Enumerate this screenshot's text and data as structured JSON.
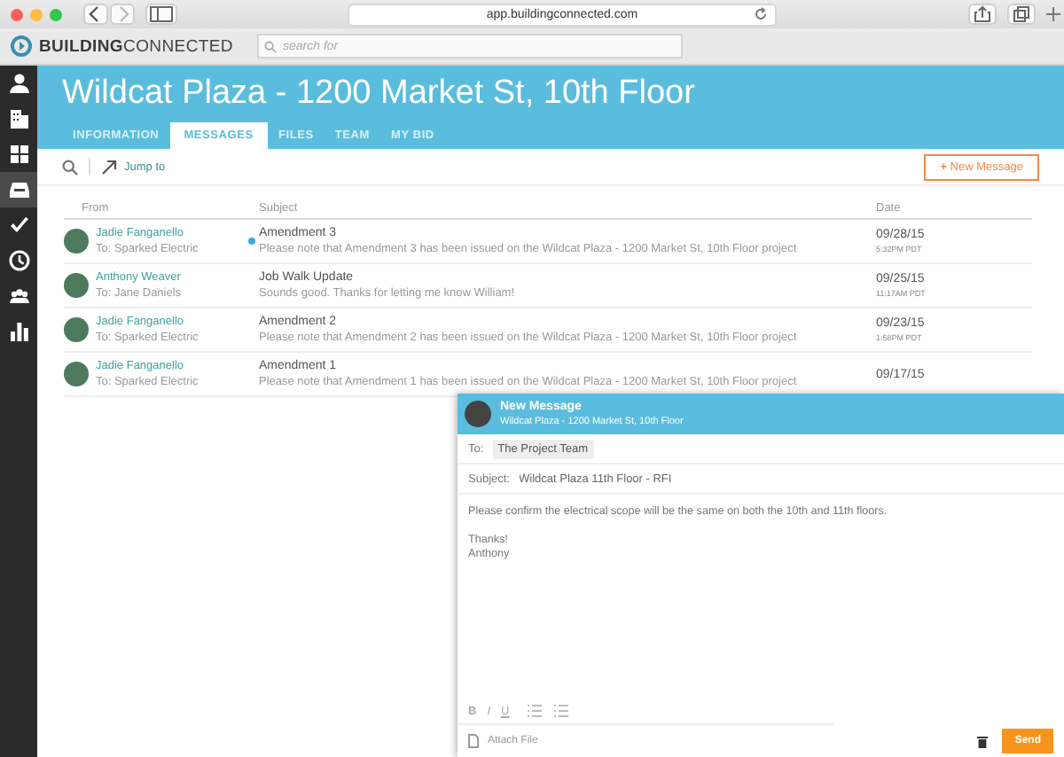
{
  "browser": {
    "url": "app.buildingconnected.com"
  },
  "app_bar": {
    "logo_bold": "BUILDING",
    "logo_light": "CONNECTED",
    "search": {
      "placeholder": "search for"
    }
  },
  "sidebar": {
    "items": [
      {
        "selected": false
      },
      {
        "selected": false
      },
      {
        "selected": false
      },
      {
        "selected": true
      },
      {
        "selected": false
      },
      {
        "selected": false
      },
      {
        "selected": false
      },
      {
        "selected": false
      }
    ]
  },
  "header": {
    "title": "Wildcat Plaza - 1200 Market St, 10th Floor"
  },
  "tabs": [
    {
      "label": "INFORMATION",
      "selected": false
    },
    {
      "label": "MESSAGES",
      "selected": true
    },
    {
      "label": "FILES",
      "selected": false
    },
    {
      "label": "TEAM",
      "selected": false
    },
    {
      "label": "MY BID",
      "selected": false
    }
  ],
  "toolbar": {
    "jump_to": "Jump to",
    "new_message": "New Message",
    "plus": "+"
  },
  "table": {
    "columns": [
      "From",
      "Subject",
      "Date"
    ],
    "rows": [
      {
        "from": "Jadie Fanganello",
        "to": "To: Sparked Electric",
        "subject": "Amendment 3",
        "preview": "Please note that Amendment 3 has been issued on the Wildcat Plaza - 1200 Market St, 10th Floor project",
        "date": "09/28/15",
        "time": "5:32PM PDT",
        "unread": true
      },
      {
        "from": "Anthony Weaver",
        "to": "To: Jane Daniels",
        "subject": "Job Walk Update",
        "preview": "Sounds good. Thanks for letting me know William!",
        "date": "09/25/15",
        "time": "11:17AM PDT",
        "unread": false
      },
      {
        "from": "Jadie Fanganello",
        "to": "To: Sparked Electric",
        "subject": "Amendment 2",
        "preview": "Please note that Amendment 2 has been issued on the Wildcat Plaza - 1200 Market St, 10th Floor project",
        "date": "09/23/15",
        "time": "1:58PM PDT",
        "unread": false
      },
      {
        "from": "Jadie Fanganello",
        "to": "To: Sparked Electric",
        "subject": "Amendment 1",
        "preview": "Please note that Amendment 1 has been issued on the Wildcat Plaza - 1200 Market St, 10th Floor project",
        "date": "09/17/15",
        "unread": false
      }
    ]
  },
  "compose": {
    "title": "New Message",
    "subtitle": "Wildcat Plaza - 1200 Market St, 10th Floor",
    "to_label": "To:",
    "recipient": "The Project Team",
    "subject_label": "Subject:",
    "subject": "Wildcat Plaza 11th Floor - RFI",
    "body": [
      "Please confirm the electrical scope will be the same on both the 10th and 11th floors.",
      "Thanks!",
      "Anthony"
    ],
    "format": [
      "B",
      "I",
      "U"
    ],
    "attach": "Attach File",
    "send": "Send"
  }
}
